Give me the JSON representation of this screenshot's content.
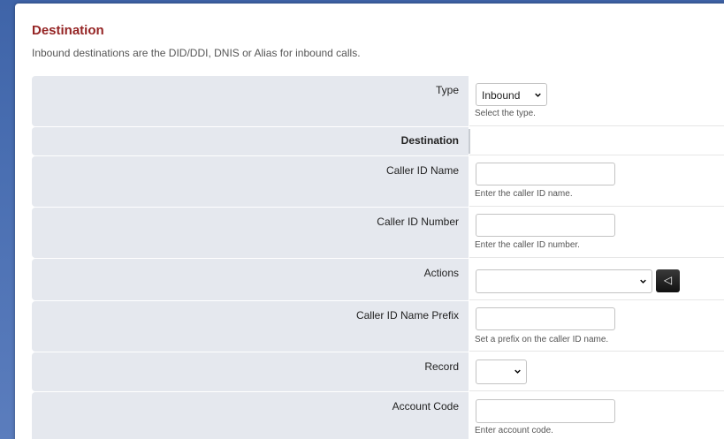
{
  "header": {
    "title": "Destination",
    "description": "Inbound destinations are the DID/DDI, DNIS or Alias for inbound calls."
  },
  "form": {
    "type": {
      "label": "Type",
      "value": "Inbound",
      "hint": "Select the type."
    },
    "section_heading": "Destination",
    "caller_id_name": {
      "label": "Caller ID Name",
      "value": "",
      "hint": "Enter the caller ID name."
    },
    "caller_id_number": {
      "label": "Caller ID Number",
      "value": "",
      "hint": "Enter the caller ID number."
    },
    "actions": {
      "label": "Actions",
      "value": "",
      "button_icon": "back-arrow-icon",
      "button_glyph": "◁"
    },
    "caller_id_name_prefix": {
      "label": "Caller ID Name Prefix",
      "value": "",
      "hint": "Set a prefix on the caller ID name."
    },
    "record": {
      "label": "Record",
      "value": ""
    },
    "account_code": {
      "label": "Account Code",
      "value": "",
      "hint": "Enter account code."
    }
  },
  "colors": {
    "title": "#952424",
    "label_bg": "#e5e8ee",
    "page_bg": "#4a6fb2"
  }
}
